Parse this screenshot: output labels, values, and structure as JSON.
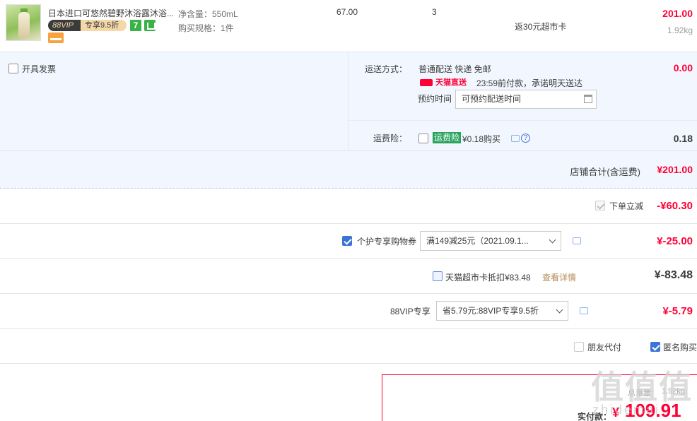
{
  "product": {
    "title": "日本进口可悠然碧野沐浴露沐浴...",
    "vip_badge_left": "88VIP",
    "vip_badge_right": "专享9.5折",
    "seven_icon": "7",
    "sku_net": "净含量：550mL",
    "sku_spec": "购买规格：1件",
    "unit_price": "67.00",
    "quantity": "3",
    "rebate": "返30元超市卡",
    "subtotal": "201.00",
    "weight": "1.92kg"
  },
  "invoice": {
    "label": "开具发票"
  },
  "delivery": {
    "label": "运送方式：",
    "method": "普通配送 快递 免邮",
    "fee": "0.00",
    "tmall_tag": "天猫直送",
    "promise": "23:59前付款，承诺明天送达",
    "appoint_label": "预约时间",
    "appoint_placeholder": "可预约配送时间"
  },
  "insurance": {
    "label": "运费险：",
    "tag": "运费险",
    "price_text": "¥0.18购买",
    "fee": "0.18",
    "help": "?"
  },
  "shop_total": {
    "label": "店铺合计(含运费)",
    "value": "¥201.00"
  },
  "discount_instant": {
    "label": "下单立减",
    "value": "-¥60.30"
  },
  "coupon": {
    "label": "个护专享购物券",
    "selected": "满149减25元（2021.09.1...",
    "value": "¥-25.00"
  },
  "supermarket_card": {
    "label": "天猫超市卡抵扣¥83.48",
    "link": "查看详情",
    "value": "¥-83.48"
  },
  "vip": {
    "label": "88VIP专享",
    "selected": "省5.79元:88VIP专享9.5折",
    "value": "¥-5.79"
  },
  "options": {
    "friend_pay": "朋友代付",
    "anonymous": "匿名购买"
  },
  "pay": {
    "weight_label": "总重量：",
    "weight": "1.92kg",
    "label": "实付款：",
    "currency": "¥",
    "value": "109.91"
  },
  "watermark": {
    "text": "值值值",
    "sub": "zhidemai"
  }
}
